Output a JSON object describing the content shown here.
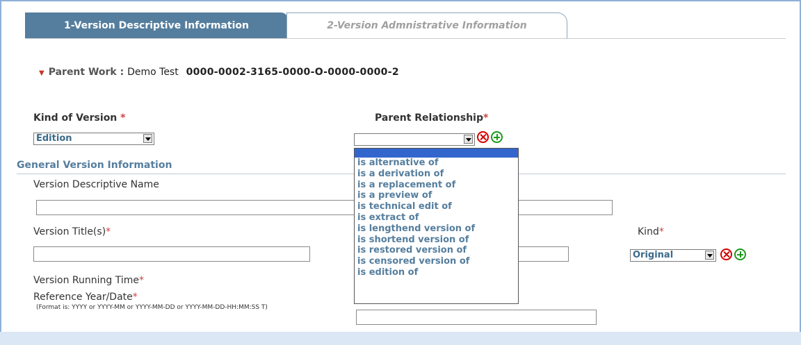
{
  "tabs": [
    {
      "label": "1-Version Descriptive Information"
    },
    {
      "label": "2-Version Admnistrative Information"
    }
  ],
  "parent_work": {
    "label": "Parent Work :",
    "title": "Demo Test",
    "code": "0000-0002-3165-0000-O-0000-0000-2"
  },
  "kind_of_version": {
    "label": "Kind of Version",
    "required": "*",
    "value": "Edition"
  },
  "parent_relationship": {
    "label": "Parent Relationship",
    "required": "*",
    "value": "",
    "options": [
      "",
      "is alternative of",
      "is a derivation of",
      "is a replacement of",
      "is a preview of",
      "is technical edit of",
      "is extract of",
      "is lengthend version of",
      "is shortend version of",
      "is restored version of",
      "is censored version of",
      "is edition of"
    ]
  },
  "section_title": "General Version Information",
  "fields": {
    "descriptive_name": {
      "label": "Version Descriptive Name",
      "value": ""
    },
    "titles": {
      "label": "Version Title(s)",
      "required": "*",
      "value": ""
    },
    "kind": {
      "label": "Kind",
      "required": "*",
      "value": "Original"
    },
    "running_time": {
      "label": "Version Running Time",
      "required": "*"
    },
    "reference_date": {
      "label": "Reference Year/Date",
      "required": "*",
      "format_hint": "(Format is: YYYY or YYYY-MM or YYYY-MM-DD or YYYY-MM-DD-HH:MM:SS T)",
      "value": ""
    }
  },
  "icons": {
    "remove": "remove-circle-icon",
    "add": "add-circle-icon",
    "expand": "triangle-down-icon"
  },
  "colors": {
    "active_tab": "#557e9e",
    "section": "#557e9e",
    "required": "#d04040",
    "remove": "#d40000",
    "add": "#1a9a1a",
    "highlight": "#3366cc"
  }
}
